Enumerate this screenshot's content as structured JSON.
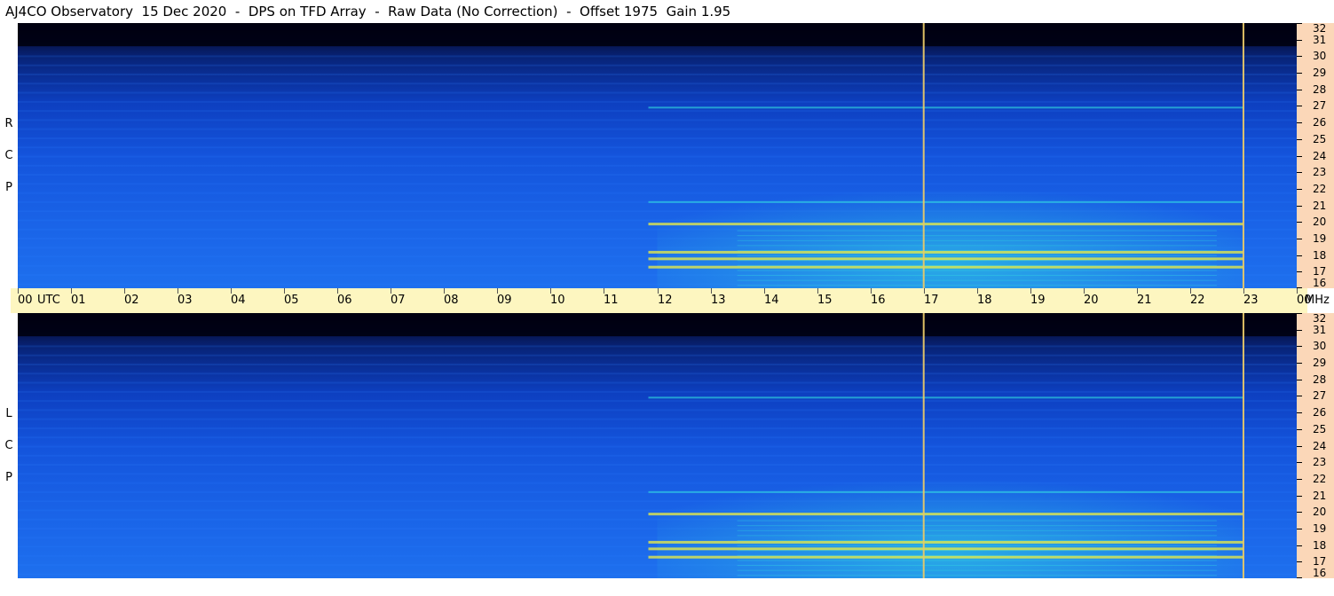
{
  "title": "AJ4CO Observatory  15 Dec 2020  -  DPS on TFD Array  -  Raw Data (No Correction)  -  Offset 1975  Gain 1.95",
  "panels": {
    "top_label": [
      "R",
      "C",
      "P"
    ],
    "bottom_label": [
      "L",
      "C",
      "P"
    ]
  },
  "time_axis": {
    "labels": [
      "00",
      "01",
      "02",
      "03",
      "04",
      "05",
      "06",
      "07",
      "08",
      "09",
      "10",
      "11",
      "12",
      "13",
      "14",
      "15",
      "16",
      "17",
      "18",
      "19",
      "20",
      "21",
      "22",
      "23",
      "00"
    ],
    "utc_label": "UTC",
    "unit_label": "MHz"
  },
  "colors": {
    "background_dark": "#000010",
    "band_blue": "#1a64e8",
    "activity_cyan": "#33e0e0",
    "activity_yellow": "#f0f040",
    "marker_line": "#e8c868",
    "time_axis_bg": "#fdf6c0",
    "freq_axis_bg": "#fbd7b8"
  },
  "chart_data": {
    "type": "heatmap",
    "title": "AJ4CO Observatory  15 Dec 2020  -  DPS on TFD Array  -  Raw Data (No Correction)  -  Offset 1975  Gain 1.95",
    "xlabel": "UTC",
    "ylabel": "MHz",
    "x_ticks": [
      "00",
      "01",
      "02",
      "03",
      "04",
      "05",
      "06",
      "07",
      "08",
      "09",
      "10",
      "11",
      "12",
      "13",
      "14",
      "15",
      "16",
      "17",
      "18",
      "19",
      "20",
      "21",
      "22",
      "23",
      "00"
    ],
    "xlim_hours": [
      0,
      24
    ],
    "ylim_mhz": [
      16,
      32
    ],
    "y_ticks": [
      16,
      17,
      18,
      19,
      20,
      21,
      22,
      23,
      24,
      25,
      26,
      27,
      28,
      29,
      30,
      31,
      32
    ],
    "panels": [
      "RCP",
      "LCP"
    ],
    "marker_lines_hours": [
      17,
      23
    ],
    "activity_window_hours": [
      12,
      23
    ],
    "strong_emission_bands_mhz": [
      17.3,
      17.8,
      18.2,
      19.9,
      21.2,
      26.9
    ]
  }
}
